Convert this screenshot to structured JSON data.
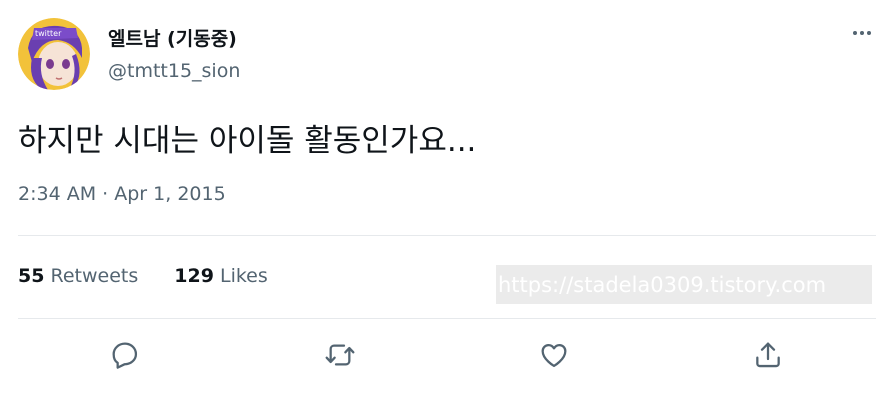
{
  "user": {
    "display_name": "엘트남 (기동중)",
    "handle": "@tmtt15_sion",
    "avatar_text": "twitter"
  },
  "tweet": {
    "text": "하지만 시대는 아이돌 활동인가요...",
    "time": "2:34 AM",
    "date": "Apr 1, 2015"
  },
  "stats": {
    "retweets_count": "55",
    "retweets_label": "Retweets",
    "likes_count": "129",
    "likes_label": "Likes"
  },
  "watermark": "https://stadela0309.tistory.com",
  "icons": {
    "more": "more-horizontal-icon",
    "reply": "reply-icon",
    "retweet": "retweet-icon",
    "like": "heart-icon",
    "share": "share-icon"
  },
  "colors": {
    "text": "#0f1419",
    "secondary": "#536471",
    "divider": "#e6e9ec",
    "icon": "#536471"
  }
}
